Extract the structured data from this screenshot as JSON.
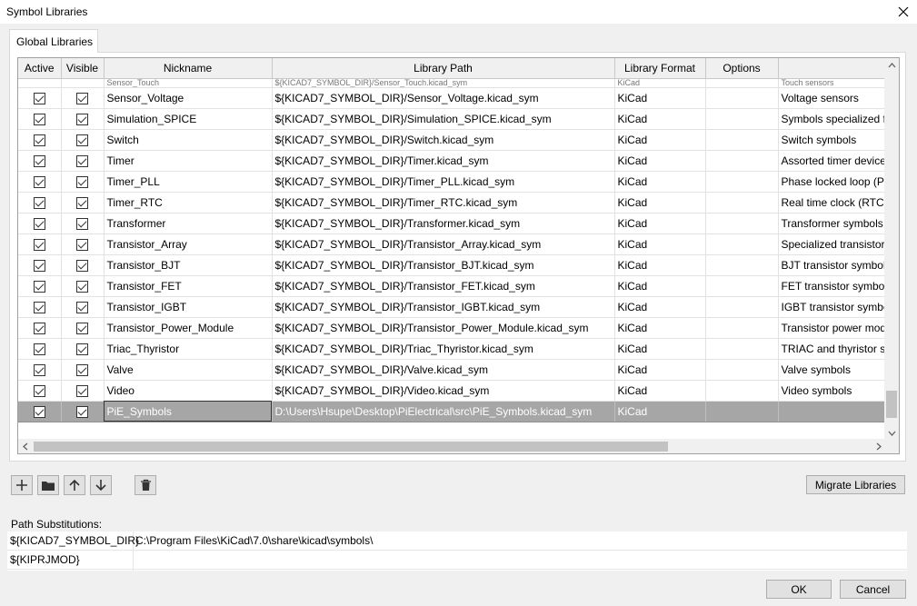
{
  "window": {
    "title": "Symbol Libraries"
  },
  "tabs": [
    {
      "label": "Global Libraries"
    }
  ],
  "columns": [
    "Active",
    "Visible",
    "Nickname",
    "Library Path",
    "Library Format",
    "Options",
    ""
  ],
  "partial_row": {
    "nickname": "Sensor_Touch",
    "path": "${KICAD7_SYMBOL_DIR}/Sensor_Touch.kicad_sym",
    "format": "KiCad",
    "description": "Touch sensors"
  },
  "rows": [
    {
      "nickname": "Sensor_Voltage",
      "path": "${KICAD7_SYMBOL_DIR}/Sensor_Voltage.kicad_sym",
      "format": "KiCad",
      "options": "",
      "description": "Voltage sensors"
    },
    {
      "nickname": "Simulation_SPICE",
      "path": "${KICAD7_SYMBOL_DIR}/Simulation_SPICE.kicad_sym",
      "format": "KiCad",
      "options": "",
      "description": "Symbols specialized fo"
    },
    {
      "nickname": "Switch",
      "path": "${KICAD7_SYMBOL_DIR}/Switch.kicad_sym",
      "format": "KiCad",
      "options": "",
      "description": "Switch symbols"
    },
    {
      "nickname": "Timer",
      "path": "${KICAD7_SYMBOL_DIR}/Timer.kicad_sym",
      "format": "KiCad",
      "options": "",
      "description": "Assorted timer device"
    },
    {
      "nickname": "Timer_PLL",
      "path": "${KICAD7_SYMBOL_DIR}/Timer_PLL.kicad_sym",
      "format": "KiCad",
      "options": "",
      "description": "Phase locked loop (PL"
    },
    {
      "nickname": "Timer_RTC",
      "path": "${KICAD7_SYMBOL_DIR}/Timer_RTC.kicad_sym",
      "format": "KiCad",
      "options": "",
      "description": "Real time clock (RTC)"
    },
    {
      "nickname": "Transformer",
      "path": "${KICAD7_SYMBOL_DIR}/Transformer.kicad_sym",
      "format": "KiCad",
      "options": "",
      "description": "Transformer symbols"
    },
    {
      "nickname": "Transistor_Array",
      "path": "${KICAD7_SYMBOL_DIR}/Transistor_Array.kicad_sym",
      "format": "KiCad",
      "options": "",
      "description": "Specialized transistor"
    },
    {
      "nickname": "Transistor_BJT",
      "path": "${KICAD7_SYMBOL_DIR}/Transistor_BJT.kicad_sym",
      "format": "KiCad",
      "options": "",
      "description": "BJT transistor symbols"
    },
    {
      "nickname": "Transistor_FET",
      "path": "${KICAD7_SYMBOL_DIR}/Transistor_FET.kicad_sym",
      "format": "KiCad",
      "options": "",
      "description": "FET transistor symbols"
    },
    {
      "nickname": "Transistor_IGBT",
      "path": "${KICAD7_SYMBOL_DIR}/Transistor_IGBT.kicad_sym",
      "format": "KiCad",
      "options": "",
      "description": "IGBT transistor symbo"
    },
    {
      "nickname": "Transistor_Power_Module",
      "path": "${KICAD7_SYMBOL_DIR}/Transistor_Power_Module.kicad_sym",
      "format": "KiCad",
      "options": "",
      "description": "Transistor power mod"
    },
    {
      "nickname": "Triac_Thyristor",
      "path": "${KICAD7_SYMBOL_DIR}/Triac_Thyristor.kicad_sym",
      "format": "KiCad",
      "options": "",
      "description": "TRIAC and thyristor sy"
    },
    {
      "nickname": "Valve",
      "path": "${KICAD7_SYMBOL_DIR}/Valve.kicad_sym",
      "format": "KiCad",
      "options": "",
      "description": "Valve symbols"
    },
    {
      "nickname": "Video",
      "path": "${KICAD7_SYMBOL_DIR}/Video.kicad_sym",
      "format": "KiCad",
      "options": "",
      "description": "Video symbols"
    },
    {
      "nickname": "PiE_Symbols",
      "path": "D:\\Users\\Hsupe\\Desktop\\PiElectrical\\src\\PiE_Symbols.kicad_sym",
      "format": "KiCad",
      "options": "",
      "description": "",
      "selected": true
    }
  ],
  "buttons": {
    "migrate": "Migrate Libraries",
    "ok": "OK",
    "cancel": "Cancel"
  },
  "toolbar_icons": [
    "add-icon",
    "folder-icon",
    "arrow-up-icon",
    "arrow-down-icon",
    "trash-icon"
  ],
  "path_substitutions": {
    "label": "Path Substitutions:",
    "rows": [
      {
        "name": "${KICAD7_SYMBOL_DIR}",
        "value": "C:\\Program Files\\KiCad\\7.0\\share\\kicad\\symbols\\"
      },
      {
        "name": "${KIPRJMOD}",
        "value": ""
      }
    ]
  },
  "colors": {
    "selected_row": "#a6a6a6",
    "header_bg": "#f0f0f0",
    "dialog_bg": "#f0f0f0"
  }
}
